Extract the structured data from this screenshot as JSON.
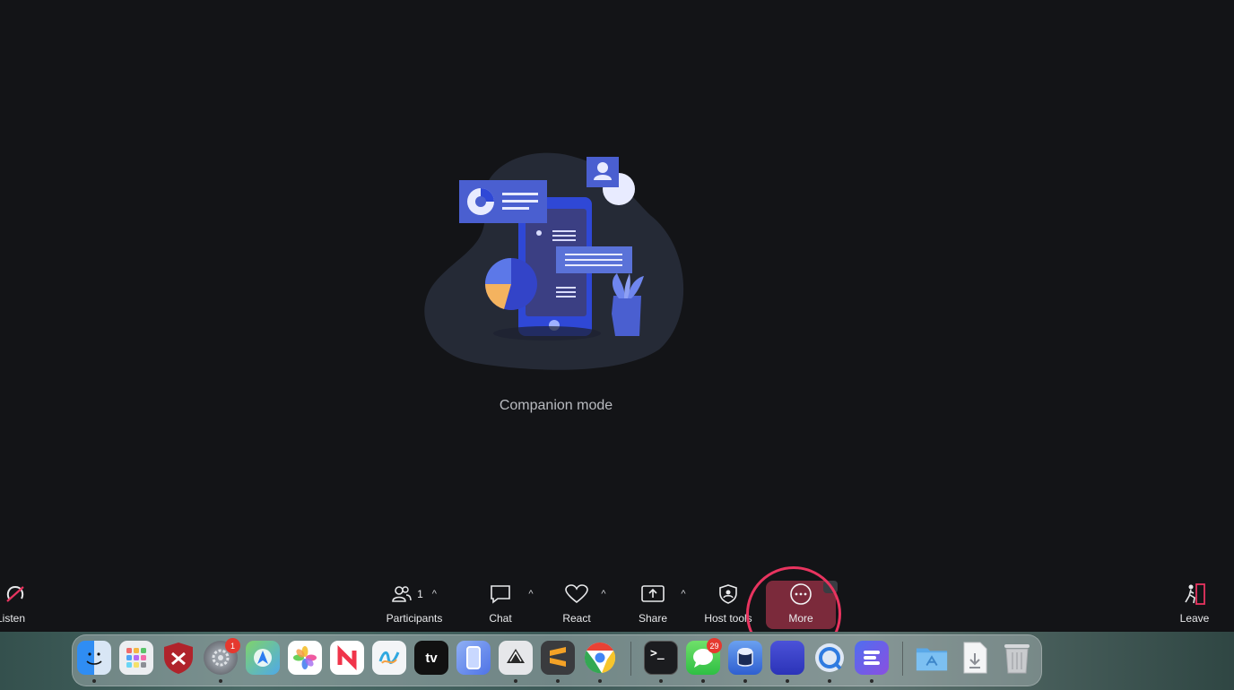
{
  "main": {
    "caption": "Companion mode"
  },
  "toolbar": {
    "listen_label": "Listen",
    "participants_label": "Participants",
    "participants_count": "1",
    "chat_label": "Chat",
    "react_label": "React",
    "share_label": "Share",
    "host_tools_label": "Host tools",
    "more_label": "More",
    "leave_label": "Leave",
    "caret": "^"
  },
  "dock": {
    "apps": [
      {
        "name": "Finder",
        "icon": "finder-icon"
      },
      {
        "name": "Launchpad",
        "icon": "launchpad-icon"
      },
      {
        "name": "Shield App",
        "icon": "shield-icon"
      },
      {
        "name": "System Settings",
        "icon": "gear-icon",
        "badge": "1"
      },
      {
        "name": "Maps",
        "icon": "maps-icon"
      },
      {
        "name": "Photos",
        "icon": "photos-icon"
      },
      {
        "name": "News",
        "icon": "news-icon"
      },
      {
        "name": "Freeform",
        "icon": "freeform-icon"
      },
      {
        "name": "Apple TV",
        "icon": "tv-icon",
        "text": "tv"
      },
      {
        "name": "Simulator",
        "icon": "phone-icon"
      },
      {
        "name": "Inkscape",
        "icon": "inkscape-icon"
      },
      {
        "name": "Sublime Text",
        "icon": "sublime-icon"
      },
      {
        "name": "Chrome",
        "icon": "chrome-icon"
      },
      {
        "name": "Terminal",
        "icon": "terminal-icon",
        "text": ">_"
      },
      {
        "name": "Messages",
        "icon": "messages-icon",
        "badge": "29"
      },
      {
        "name": "Database App",
        "icon": "database-icon"
      },
      {
        "name": "Zoom",
        "icon": "zoom-icon"
      },
      {
        "name": "QuickTime",
        "icon": "quicktime-icon"
      },
      {
        "name": "Stack App",
        "icon": "stack-icon"
      },
      {
        "name": "Applications Folder",
        "icon": "folder-icon"
      },
      {
        "name": "Downloads",
        "icon": "download-file-icon"
      },
      {
        "name": "Trash",
        "icon": "trash-icon"
      }
    ]
  },
  "colors": {
    "background": "#131417",
    "accent_ring": "#e8345f",
    "illustration_blue": "#4a5fd0",
    "blob": "#252a36"
  }
}
